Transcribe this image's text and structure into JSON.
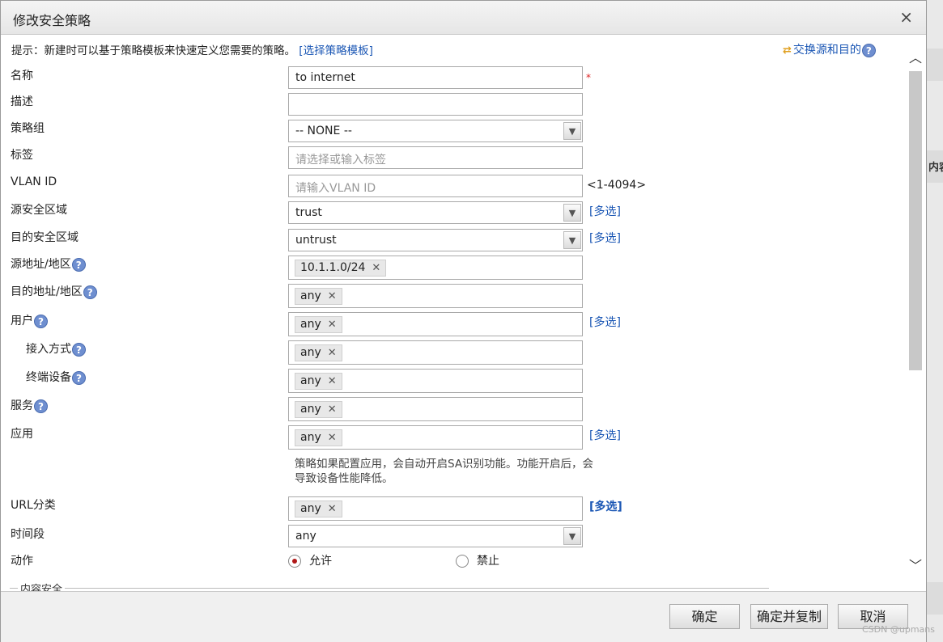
{
  "dialog": {
    "title": "修改安全策略",
    "close_glyph": "×"
  },
  "hint": {
    "text": "提示：新建时可以基于策略模板来快速定义您需要的策略。",
    "link": "[选择策略模板]"
  },
  "swap": {
    "label": "交换源和目的"
  },
  "help_glyph": "?",
  "required_mark": "*",
  "form": {
    "name": {
      "label": "名称",
      "value": "to internet"
    },
    "description": {
      "label": "描述",
      "value": ""
    },
    "policy_group": {
      "label": "策略组",
      "value": "-- NONE --"
    },
    "tag": {
      "label": "标签",
      "placeholder": "请选择或输入标签"
    },
    "vlan": {
      "label": "VLAN ID",
      "placeholder": "请输入VLAN ID",
      "range": "<1-4094>"
    },
    "src_zone": {
      "label": "源安全区域",
      "value": "trust",
      "multi": "[多选]"
    },
    "dst_zone": {
      "label": "目的安全区域",
      "value": "untrust",
      "multi": "[多选]"
    },
    "src_addr": {
      "label": "源地址/地区",
      "tag": "10.1.1.0/24"
    },
    "dst_addr": {
      "label": "目的地址/地区",
      "tag": "any"
    },
    "user": {
      "label": "用户",
      "tag": "any",
      "multi": "[多选]"
    },
    "access": {
      "label": "接入方式",
      "tag": "any"
    },
    "terminal": {
      "label": "终端设备",
      "tag": "any"
    },
    "service": {
      "label": "服务",
      "tag": "any"
    },
    "application": {
      "label": "应用",
      "tag": "any",
      "multi": "[多选]"
    },
    "app_note": "策略如果配置应用，会自动开启SA识别功能。功能开启后，会导致设备性能降低。",
    "url_category": {
      "label": "URL分类",
      "tag": "any",
      "multi": "[多选]"
    },
    "time_range": {
      "label": "时间段",
      "value": "any"
    },
    "action": {
      "label": "动作",
      "permit": "允许",
      "deny": "禁止",
      "selected": "允许"
    },
    "content_security": "内容安全"
  },
  "tag_remove_glyph": "✕",
  "buttons": {
    "ok": "确定",
    "ok_copy": "确定并复制",
    "cancel": "取消"
  },
  "background": {
    "right_label": "内容"
  },
  "watermark": "CSDN @upmans"
}
